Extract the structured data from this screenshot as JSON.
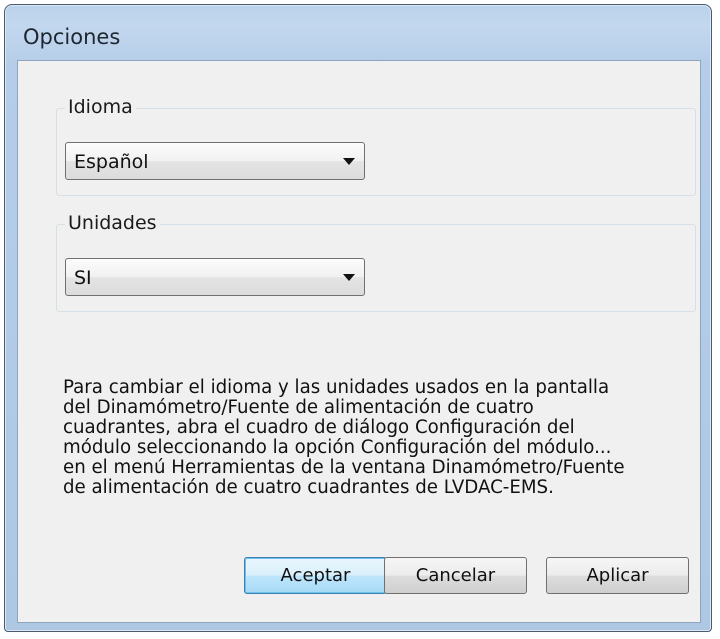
{
  "window": {
    "title": "Opciones"
  },
  "language_group": {
    "label": "Idioma",
    "selected": "Español"
  },
  "units_group": {
    "label": "Unidades",
    "selected": "SI"
  },
  "info_lines": [
    "Para cambiar el idioma y las unidades usados en la pantalla",
    "del Dinamómetro/Fuente de alimentación de cuatro",
    "cuadrantes, abra el cuadro de diálogo Configuración del",
    "módulo seleccionando la opción Configuración del módulo...",
    "en el menú Herramientas de la ventana Dinamómetro/Fuente",
    "de alimentación de cuatro cuadrantes de LVDAC-EMS."
  ],
  "buttons": {
    "ok": "Aceptar",
    "cancel": "Cancelar",
    "apply": "Aplicar"
  },
  "icons": {
    "dropdown": "chevron-down-icon"
  }
}
